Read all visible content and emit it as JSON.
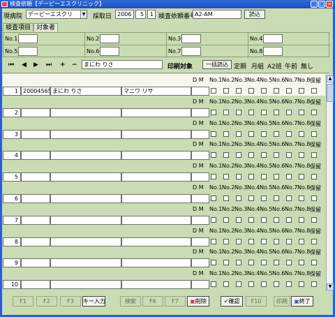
{
  "window": {
    "title": "検査依頼【デーピーエスクリニック】"
  },
  "header": {
    "hospital_label": "現病院",
    "hospital_value": "デーピーエスクリ",
    "sample_date_label": "採取日",
    "year": "2006",
    "month": "5",
    "day": "1",
    "request_no_label": "検査依頼番号",
    "request_no_value": "A2-AM",
    "read_button": "読込"
  },
  "tabs": [
    "検査項目",
    "対象者"
  ],
  "no_fields": [
    "No.1",
    "No.2",
    "No.3",
    "No.4",
    "No.5",
    "No.6",
    "No.7",
    "No.8"
  ],
  "nav": {
    "first": "⏮",
    "prev": "◀",
    "next": "▶",
    "last": "⏭",
    "add": "+",
    "remove": "−",
    "current_name": "まにわ りさ",
    "print_target_label": "印刷対象",
    "batch_read_button": "一括読込",
    "filters": [
      "定期",
      "月組",
      "A2班",
      "午前",
      "無し"
    ]
  },
  "columns": {
    "dm": "D M",
    "checks": [
      "No.1",
      "No.2",
      "No.3",
      "No.4",
      "No.5",
      "No.6",
      "No.7",
      "No.8",
      "保留"
    ]
  },
  "records": [
    {
      "idx": "1",
      "code": "20004565",
      "name": "まにわ りさ",
      "kana": "マニワ リサ"
    },
    {
      "idx": "2",
      "code": "",
      "name": "",
      "kana": ""
    },
    {
      "idx": "3",
      "code": "",
      "name": "",
      "kana": ""
    },
    {
      "idx": "4",
      "code": "",
      "name": "",
      "kana": ""
    },
    {
      "idx": "5",
      "code": "",
      "name": "",
      "kana": ""
    },
    {
      "idx": "6",
      "code": "",
      "name": "",
      "kana": ""
    },
    {
      "idx": "7",
      "code": "",
      "name": "",
      "kana": ""
    },
    {
      "idx": "8",
      "code": "",
      "name": "",
      "kana": ""
    },
    {
      "idx": "9",
      "code": "",
      "name": "",
      "kana": ""
    },
    {
      "idx": "10",
      "code": "",
      "name": "",
      "kana": ""
    }
  ],
  "footer": {
    "f1": "F1",
    "f2": "F2",
    "f3": "F3",
    "key_input": "キー入力",
    "search": "検索",
    "f6": "F6",
    "f7": "F7",
    "delete": "削除",
    "confirm": "確認",
    "f10": "F10",
    "print": "印刷",
    "exit": "終了"
  }
}
